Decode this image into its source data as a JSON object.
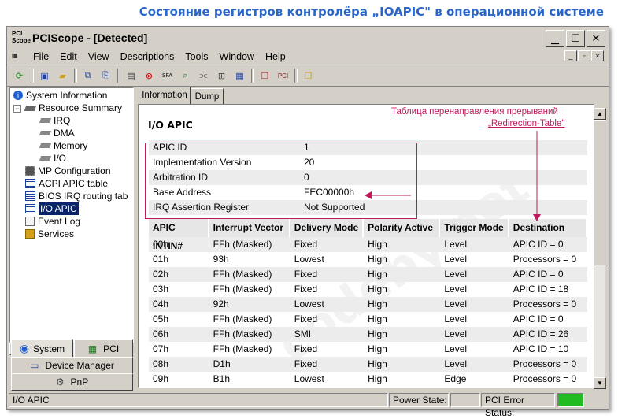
{
  "caption": "Состояние регистров контролёра „IOAPIC\" в операционной системе",
  "window": {
    "app_title": "PCIScope - [Detected]",
    "icon_text": "PCI Scope"
  },
  "menu": [
    "File",
    "Edit",
    "View",
    "Descriptions",
    "Tools",
    "Window",
    "Help"
  ],
  "tree": {
    "system_information": "System Information",
    "resource_summary": "Resource Summary",
    "irq": "IRQ",
    "dma": "DMA",
    "memory": "Memory",
    "io": "I/O",
    "mp_configuration": "MP Configuration",
    "acpi_apic_table": "ACPI APIC table",
    "bios_irq": "BIOS IRQ routing tab",
    "io_apic": "I/O APIC",
    "event_log": "Event Log",
    "services": "Services"
  },
  "left_buttons": {
    "system": "System",
    "pci": "PCI",
    "device_manager": "Device Manager",
    "pnp": "PnP"
  },
  "tabs": [
    "Information",
    "Dump"
  ],
  "content": {
    "title": "I/O APIC",
    "info_rows": [
      {
        "key": "APIC ID",
        "value": "1"
      },
      {
        "key": "Implementation Version",
        "value": "20"
      },
      {
        "key": "Arbitration ID",
        "value": "0"
      },
      {
        "key": "Base Address",
        "value": "FEC00000h"
      },
      {
        "key": "IRQ Assertion Register",
        "value": "Not Supported"
      }
    ],
    "columns": [
      "APIC INTIN#",
      "Interrupt Vector",
      "Delivery Mode",
      "Polarity Active",
      "Trigger Mode",
      "Destination"
    ],
    "rows": [
      [
        "00h",
        "FFh (Masked)",
        "Fixed",
        "High",
        "Level",
        "APIC ID = 0"
      ],
      [
        "01h",
        "93h",
        "Lowest",
        "High",
        "Level",
        "Processors = 0"
      ],
      [
        "02h",
        "FFh (Masked)",
        "Fixed",
        "High",
        "Level",
        "APIC ID = 0"
      ],
      [
        "03h",
        "FFh (Masked)",
        "Fixed",
        "High",
        "Level",
        "APIC ID = 18"
      ],
      [
        "04h",
        "92h",
        "Lowest",
        "High",
        "Level",
        "Processors = 0"
      ],
      [
        "05h",
        "FFh (Masked)",
        "Fixed",
        "High",
        "Level",
        "APIC ID = 0"
      ],
      [
        "06h",
        "FFh (Masked)",
        "SMI",
        "High",
        "Level",
        "APIC ID = 26"
      ],
      [
        "07h",
        "FFh (Masked)",
        "Fixed",
        "High",
        "Level",
        "APIC ID = 10"
      ],
      [
        "08h",
        "D1h",
        "Fixed",
        "High",
        "Level",
        "Processors = 0"
      ],
      [
        "09h",
        "B1h",
        "Lowest",
        "High",
        "Edge",
        "Processors = 0"
      ]
    ]
  },
  "annotation": {
    "line1": "Таблица перенаправления прерываний",
    "line2": "„Redirection-Table\""
  },
  "statusbar": {
    "left": "I/O APIC",
    "power_state": "Power State:",
    "pci_error": "PCI Error Status:"
  },
  "watermark": "codeby.net",
  "colors": {
    "selection": "#0a246a",
    "annotation": "#c0195c",
    "caption": "#2a66c8",
    "status_ok": "#22bb22"
  }
}
